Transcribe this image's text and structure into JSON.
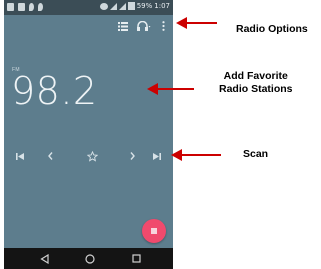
{
  "statusbar": {
    "battery": "59%",
    "time": "1:07"
  },
  "radio": {
    "band": "FM",
    "frequency": "98.2"
  },
  "icons": {
    "station_list": "list-icon",
    "headphones": "headphones-icon",
    "more": "more-vert-icon",
    "prev_station": "skip-previous-icon",
    "prev": "chevron-left-icon",
    "favorite": "star-outline-icon",
    "next": "chevron-right-icon",
    "next_station": "skip-next-icon",
    "stop": "stop-icon",
    "back": "back-triangle-icon",
    "home": "home-circle-icon",
    "recent": "recent-square-icon"
  },
  "colors": {
    "screen": "#5d7d8d",
    "accent_fab": "#f04a6d",
    "annotation_arrow": "#cc0000"
  },
  "annotations": {
    "radio_options": "Radio Options",
    "favorite_line1": "Add Favorite",
    "favorite_line2": "Radio Stations",
    "scan": "Scan"
  }
}
